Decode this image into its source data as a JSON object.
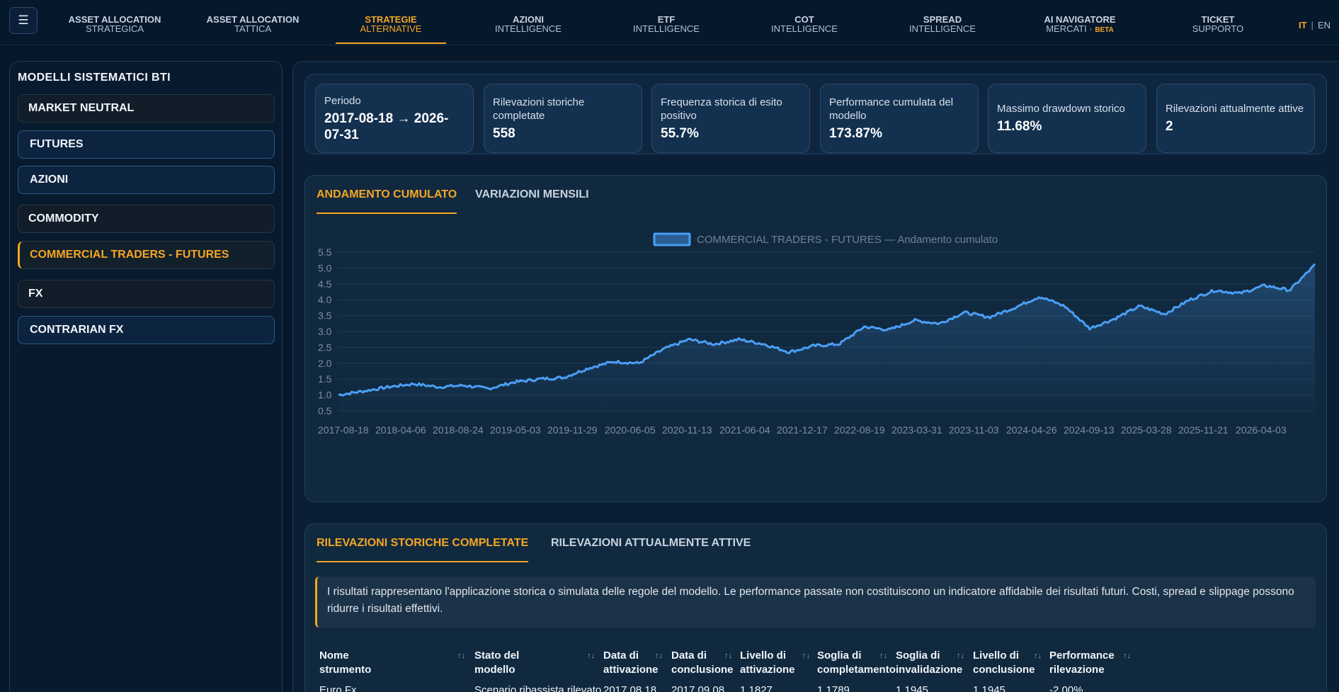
{
  "nav": {
    "menu_icon": "menu-icon",
    "items": [
      {
        "l1": "ASSET ALLOCATION",
        "l2": "STRATEGICA"
      },
      {
        "l1": "ASSET ALLOCATION",
        "l2": "TATTICA"
      },
      {
        "l1": "STRATEGIE",
        "l2": "ALTERNATIVE"
      },
      {
        "l1": "AZIONI",
        "l2": "INTELLIGENCE"
      },
      {
        "l1": "ETF",
        "l2": "INTELLIGENCE"
      },
      {
        "l1": "COT",
        "l2": "INTELLIGENCE"
      },
      {
        "l1": "SPREAD",
        "l2": "INTELLIGENCE"
      },
      {
        "l1": "AI NAVIGATORE",
        "l2": "MERCATI ·",
        "badge": "BETA"
      },
      {
        "l1": "TICKET",
        "l2": "SUPPORTO"
      }
    ],
    "lang": {
      "it": "IT",
      "sep": "|",
      "en": "EN"
    }
  },
  "sidebar": {
    "title": "MODELLI SISTEMATICI BTI",
    "items": [
      {
        "label": "MARKET NEUTRAL"
      },
      {
        "label": "FUTURES"
      },
      {
        "label": "AZIONI"
      },
      {
        "label": "COMMODITY"
      },
      {
        "label": "COMMERCIAL TRADERS - FUTURES"
      },
      {
        "label": "FX"
      },
      {
        "label": "CONTRARIAN FX"
      }
    ]
  },
  "stats": [
    {
      "label": "Periodo",
      "value": "2017-08-18 → 2026-07-31"
    },
    {
      "label": "Rilevazioni storiche completate",
      "value": "558"
    },
    {
      "label": "Frequenza storica di esito positivo",
      "value": "55.7%"
    },
    {
      "label": "Performance cumulata del modello",
      "value": "173.87%"
    },
    {
      "label": "Massimo drawdown storico",
      "value": "11.68%"
    },
    {
      "label": "Rilevazioni attualmente attive",
      "value": "2"
    }
  ],
  "chart_tabs": {
    "cumulative": "ANDAMENTO CUMULATO",
    "monthly": "VARIAZIONI MENSILI"
  },
  "colors": {
    "accent": "#f5a623",
    "line": "#4a9ff5",
    "panel": "#10293f"
  },
  "chart_data": {
    "type": "line",
    "title": "",
    "xlabel": "",
    "ylabel": "",
    "ylim": [
      0.5,
      5.5
    ],
    "yticks": [
      0.5,
      1.0,
      1.5,
      2.0,
      2.5,
      3.0,
      3.5,
      4.0,
      4.5,
      5.0,
      5.5
    ],
    "ytick_labels": [
      "0.5",
      "1.0",
      "1.5",
      "2.0",
      "2.5",
      "3.0",
      "3.5",
      "4.0",
      "4.5",
      "5.0",
      "5.5"
    ],
    "xtick_labels": [
      "2017-08-18",
      "2018-04-06",
      "2018-08-24",
      "2019-05-03",
      "2019-11-29",
      "2020-06-05",
      "2020-11-13",
      "2021-06-04",
      "2021-12-17",
      "2022-08-19",
      "2023-03-31",
      "2023-11-03",
      "2024-04-26",
      "2024-09-13",
      "2025-03-28",
      "2025-11-21",
      "2026-04-03"
    ],
    "grid": true,
    "legend": "top-center",
    "series": [
      {
        "name": "COMMERCIAL TRADERS - FUTURES — Andamento cumulato",
        "x": [
          "2017-08-18",
          "2017-10",
          "2017-12",
          "2018-02",
          "2018-04-06",
          "2018-06",
          "2018-08-24",
          "2018-11",
          "2019-02",
          "2019-05-03",
          "2019-08",
          "2019-11-29",
          "2020-02",
          "2020-04",
          "2020-06-05",
          "2020-08",
          "2020-11-13",
          "2021-02",
          "2021-06-04",
          "2021-09",
          "2021-12-17",
          "2022-03",
          "2022-06",
          "2022-08-19",
          "2022-11",
          "2023-03-31",
          "2023-06",
          "2023-09",
          "2023-11-03",
          "2024-01",
          "2024-04-26",
          "2024-07",
          "2024-09-13",
          "2024-12",
          "2025-03-28",
          "2025-07",
          "2025-11-21",
          "2026-02",
          "2026-04-03",
          "2026-07-31"
        ],
        "y": [
          1.0,
          1.12,
          1.25,
          1.35,
          1.25,
          1.3,
          1.2,
          1.4,
          1.5,
          1.55,
          1.85,
          2.05,
          2.0,
          2.45,
          2.75,
          2.6,
          2.75,
          2.6,
          2.35,
          2.55,
          2.6,
          3.15,
          3.05,
          3.35,
          3.25,
          3.6,
          3.45,
          3.75,
          4.1,
          3.8,
          3.1,
          3.4,
          3.8,
          3.55,
          4.0,
          4.3,
          4.2,
          4.45,
          4.3,
          5.1
        ]
      }
    ]
  },
  "table_tabs": {
    "completed": "RILEVAZIONI STORICHE COMPLETATE",
    "active": "RILEVAZIONI ATTUALMENTE ATTIVE"
  },
  "disclaimer": "I risultati rappresentano l'applicazione storica o simulata delle regole del modello. Le performance passate non costituiscono un indicatore affidabile dei risultati futuri. Costi, spread e slippage possono ridurre i risultati effettivi.",
  "table": {
    "columns": [
      {
        "l1": "Nome",
        "l2": "strumento"
      },
      {
        "l1": "Stato del",
        "l2": "modello"
      },
      {
        "l1": "Data di",
        "l2": "attivazione"
      },
      {
        "l1": "Data di",
        "l2": "conclusione"
      },
      {
        "l1": "Livello di",
        "l2": "attivazione"
      },
      {
        "l1": "Soglia di",
        "l2": "completamento"
      },
      {
        "l1": "Soglia di",
        "l2": "invalidazione"
      },
      {
        "l1": "Livello di",
        "l2": "conclusione"
      },
      {
        "l1": "Performance",
        "l2": "rilevazione"
      }
    ],
    "sort_icon": "↑↓",
    "rows": [
      [
        "Euro Fx",
        "Scenario ribassista rilevato",
        "2017.08.18",
        "2017.09.08",
        "1.1827",
        "1.1789",
        "1.1945",
        "1.1945",
        "-2.00%"
      ]
    ]
  }
}
